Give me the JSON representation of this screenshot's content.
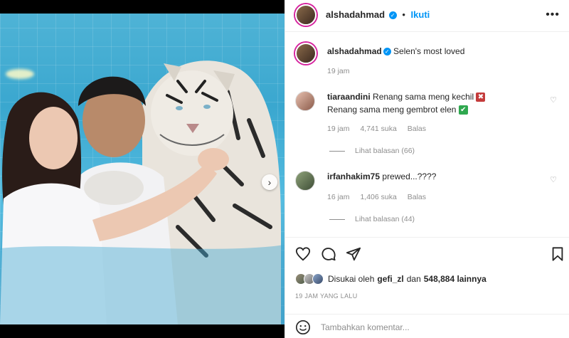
{
  "post": {
    "author": "alshadahmad",
    "follow_label": "Ikuti",
    "more_label": "•••",
    "separator": "•"
  },
  "caption": {
    "username": "alshadahmad",
    "text": "Selen's most loved",
    "time": "19 jam"
  },
  "comments": [
    {
      "username": "tiaraandini",
      "line1": "Renang sama meng kechil",
      "line1_emoji": "✖",
      "line2": "Renang sama meng gembrot elen",
      "line2_emoji": "✔",
      "time": "19 jam",
      "likes": "4,741 suka",
      "reply": "Balas",
      "view_replies": "Lihat balasan (66)"
    },
    {
      "username": "irfanhakim75",
      "text": "prewed...????",
      "time": "16 jam",
      "likes": "1,406 suka",
      "reply": "Balas",
      "view_replies": "Lihat balasan (44)"
    }
  ],
  "likes": {
    "prefix": "Disukai oleh",
    "user": "gefi_zl",
    "middle": "dan",
    "count": "548,884 lainnya"
  },
  "timestamp": "19 JAM YANG LALU",
  "add_comment": {
    "placeholder": "Tambahkan komentar..."
  },
  "carousel": {
    "next": "›",
    "total": 2,
    "active": 1
  },
  "colors": {
    "accent": "#0095f6",
    "text": "#262626",
    "muted": "#8e8e8e",
    "ring": "#d6249f"
  },
  "icons": {
    "like": "heart-icon",
    "comment": "comment-icon",
    "share": "paper-plane-icon",
    "save": "bookmark-icon",
    "emoji": "smiley-icon",
    "verified": "verified-badge-icon"
  }
}
